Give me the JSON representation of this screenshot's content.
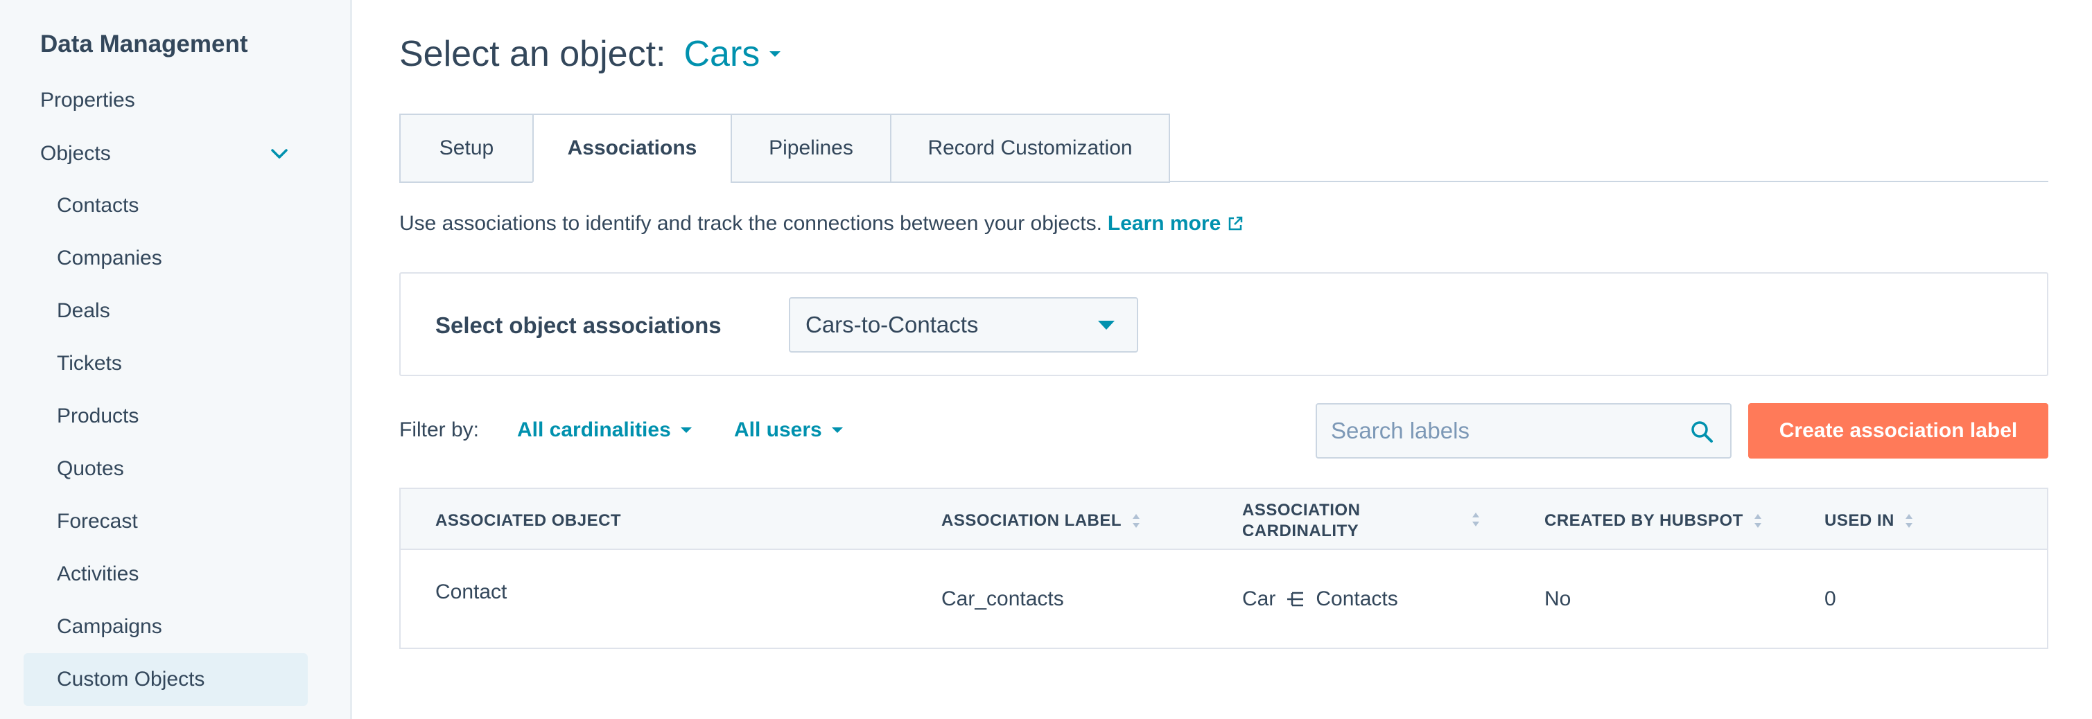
{
  "sidebar": {
    "heading": "Data Management",
    "items": [
      {
        "label": "Properties"
      },
      {
        "label": "Objects"
      }
    ],
    "sub_items": [
      {
        "label": "Contacts"
      },
      {
        "label": "Companies"
      },
      {
        "label": "Deals"
      },
      {
        "label": "Tickets"
      },
      {
        "label": "Products"
      },
      {
        "label": "Quotes"
      },
      {
        "label": "Forecast"
      },
      {
        "label": "Activities"
      },
      {
        "label": "Campaigns"
      },
      {
        "label": "Custom Objects"
      }
    ]
  },
  "header": {
    "title": "Select an object:",
    "object": "Cars"
  },
  "tabs": [
    {
      "label": "Setup"
    },
    {
      "label": "Associations"
    },
    {
      "label": "Pipelines"
    },
    {
      "label": "Record Customization"
    }
  ],
  "intro": {
    "text": "Use associations to identify and track the connections between your objects.",
    "link": "Learn more"
  },
  "association_select": {
    "label": "Select object associations",
    "value": "Cars-to-Contacts"
  },
  "filters": {
    "label": "Filter by:",
    "cardinality": "All cardinalities",
    "users": "All users"
  },
  "search": {
    "placeholder": "Search labels"
  },
  "create_button": "Create association label",
  "table": {
    "headers": {
      "object": "ASSOCIATED OBJECT",
      "label": "ASSOCIATION LABEL",
      "cardinality_1": "ASSOCIATION",
      "cardinality_2": "CARDINALITY",
      "created": "CREATED BY HUBSPOT",
      "used": "USED IN"
    },
    "rows": [
      {
        "object": "Contact",
        "label": "Car_contacts",
        "from": "Car",
        "to": "Contacts",
        "created": "No",
        "used": "0"
      }
    ]
  },
  "colors": {
    "accent": "#0091ae",
    "primary_button": "#ff7a59",
    "text": "#33475b"
  }
}
